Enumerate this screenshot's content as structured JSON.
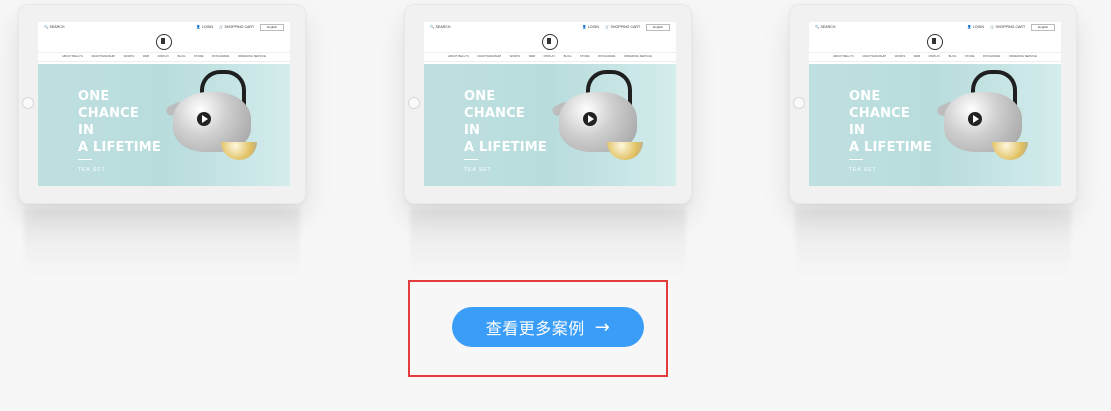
{
  "tablets": [
    {
      "site_top": {
        "search": "SEARCH",
        "login": "LOGIN",
        "cart": "SHOPPING CART",
        "language": "English"
      },
      "nav": [
        "ABOUT BELLYS",
        "CRAFTSMANSHIP",
        "WORKS",
        "WEB",
        "DISPLAY",
        "BLOG",
        "STORE",
        "PATCHWARE",
        "ORDERING SERVICE"
      ],
      "hero": {
        "line1": "ONE",
        "line2": "CHANCE",
        "line3": "IN",
        "line4": "A LIFETIME",
        "sub": "TEA SET"
      }
    },
    {
      "site_top": {
        "search": "SEARCH",
        "login": "LOGIN",
        "cart": "SHOPPING CART",
        "language": "English"
      },
      "nav": [
        "ABOUT BELLYS",
        "CRAFTSMANSHIP",
        "WORKS",
        "WEB",
        "DISPLAY",
        "BLOG",
        "STORE",
        "PATCHWARE",
        "ORDERING SERVICE"
      ],
      "hero": {
        "line1": "ONE",
        "line2": "CHANCE",
        "line3": "IN",
        "line4": "A LIFETIME",
        "sub": "TEA SET"
      }
    },
    {
      "site_top": {
        "search": "SEARCH",
        "login": "LOGIN",
        "cart": "SHOPPING CART",
        "language": "English"
      },
      "nav": [
        "ABOUT BELLYS",
        "CRAFTSMANSHIP",
        "WORKS",
        "WEB",
        "DISPLAY",
        "BLOG",
        "STORE",
        "PATCHWARE",
        "ORDERING SERVICE"
      ],
      "hero": {
        "line1": "ONE",
        "line2": "CHANCE",
        "line3": "IN",
        "line4": "A LIFETIME",
        "sub": "TEA SET"
      }
    }
  ],
  "cta": {
    "label": "查看更多案例",
    "arrow": "→"
  },
  "colors": {
    "accent": "#3a9df7",
    "highlight_frame": "#e23c3c",
    "hero_bg": "#bfe0e0"
  },
  "icons": {
    "search": "search-icon",
    "login": "user-icon",
    "cart": "cart-icon",
    "play": "play-icon",
    "arrow": "arrow-right-icon"
  }
}
